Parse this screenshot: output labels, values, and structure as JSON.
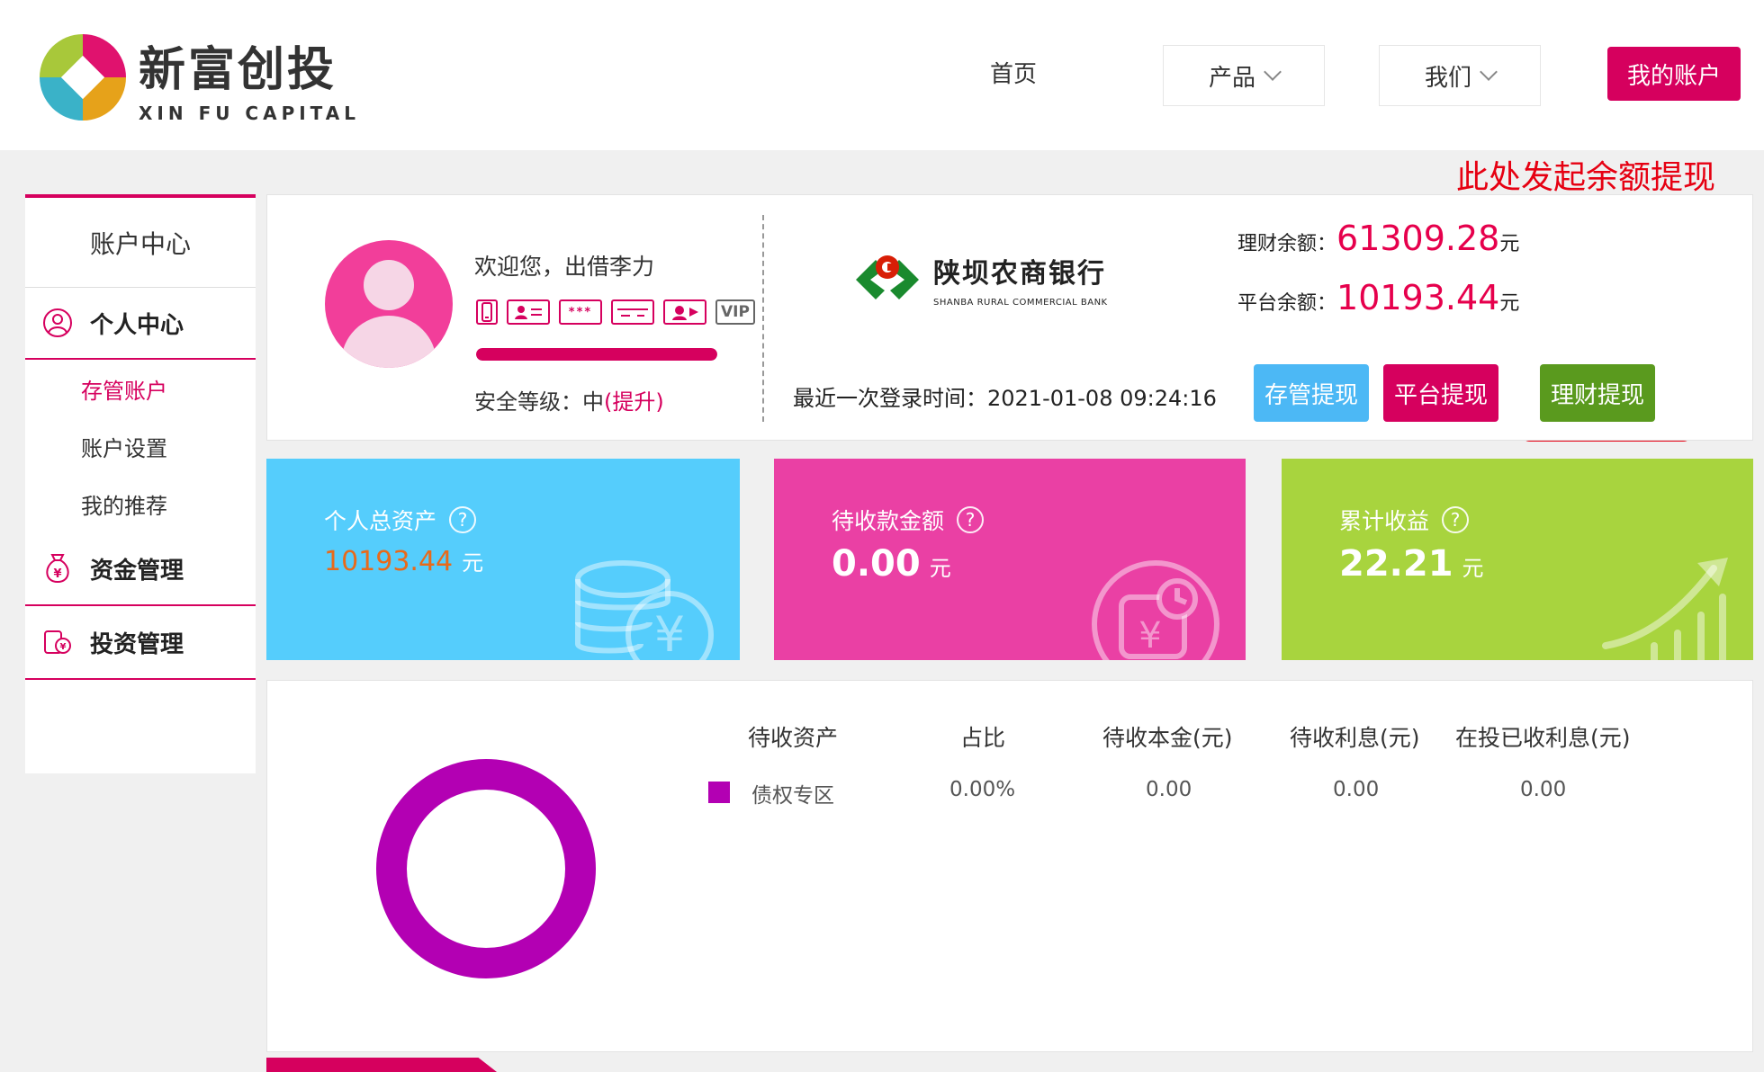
{
  "header": {
    "logo_cn": "新富创投",
    "logo_en": "XIN FU CAPITAL",
    "nav_home": "首页",
    "nav_products": "产品",
    "nav_us": "我们",
    "nav_account": "我的账户"
  },
  "annotation": {
    "text": "此处发起余额提现",
    "color": "#e60012"
  },
  "sidebar": {
    "title": "账户中心",
    "groups": [
      {
        "label": "个人中心",
        "icon": "user-circle-icon",
        "items": [
          {
            "label": "存管账户",
            "active": true
          },
          {
            "label": "账户设置",
            "active": false
          },
          {
            "label": "我的推荐",
            "active": false
          }
        ]
      },
      {
        "label": "资金管理",
        "icon": "money-bag-icon"
      },
      {
        "label": "投资管理",
        "icon": "investment-icon"
      }
    ]
  },
  "profile": {
    "welcome": "欢迎您，出借李力",
    "badges": [
      "phone-icon",
      "id-card-icon",
      "password-icon",
      "bank-card-icon",
      "video-icon"
    ],
    "vip": "VIP",
    "security_progress": 1.0,
    "security_label": "安全等级：中",
    "security_up": "(提升)",
    "bank_name_cn": "陕坝农商银行",
    "bank_name_en": "SHANBA RURAL COMMERCIAL BANK",
    "last_login": "最近一次登录时间：2021-01-08 09:24:16",
    "finance_balance_label": "理财余额：",
    "finance_balance": "61309.28",
    "platform_balance_label": "平台余额：",
    "platform_balance": "10193.44",
    "unit": "元",
    "btn_custody": "存管提现",
    "btn_platform": "平台提现",
    "btn_finance": "理财提现"
  },
  "stats": [
    {
      "label": "个人总资产",
      "value": "10193.44",
      "unit": "元",
      "color": "#55cdfc"
    },
    {
      "label": "待收款金额",
      "value": "0.00",
      "unit": "元",
      "color": "#ea40a4"
    },
    {
      "label": "累计收益",
      "value": "22.21",
      "unit": "元",
      "color": "#a8d43e"
    }
  ],
  "assets_table": {
    "headers": [
      "待收资产",
      "占比",
      "待收本金(元)",
      "待收利息(元)",
      "在投已收利息(元)"
    ],
    "rows": [
      [
        "债权专区",
        "0.00%",
        "0.00",
        "0.00",
        "0.00"
      ]
    ],
    "series_color": "#b300b3"
  }
}
